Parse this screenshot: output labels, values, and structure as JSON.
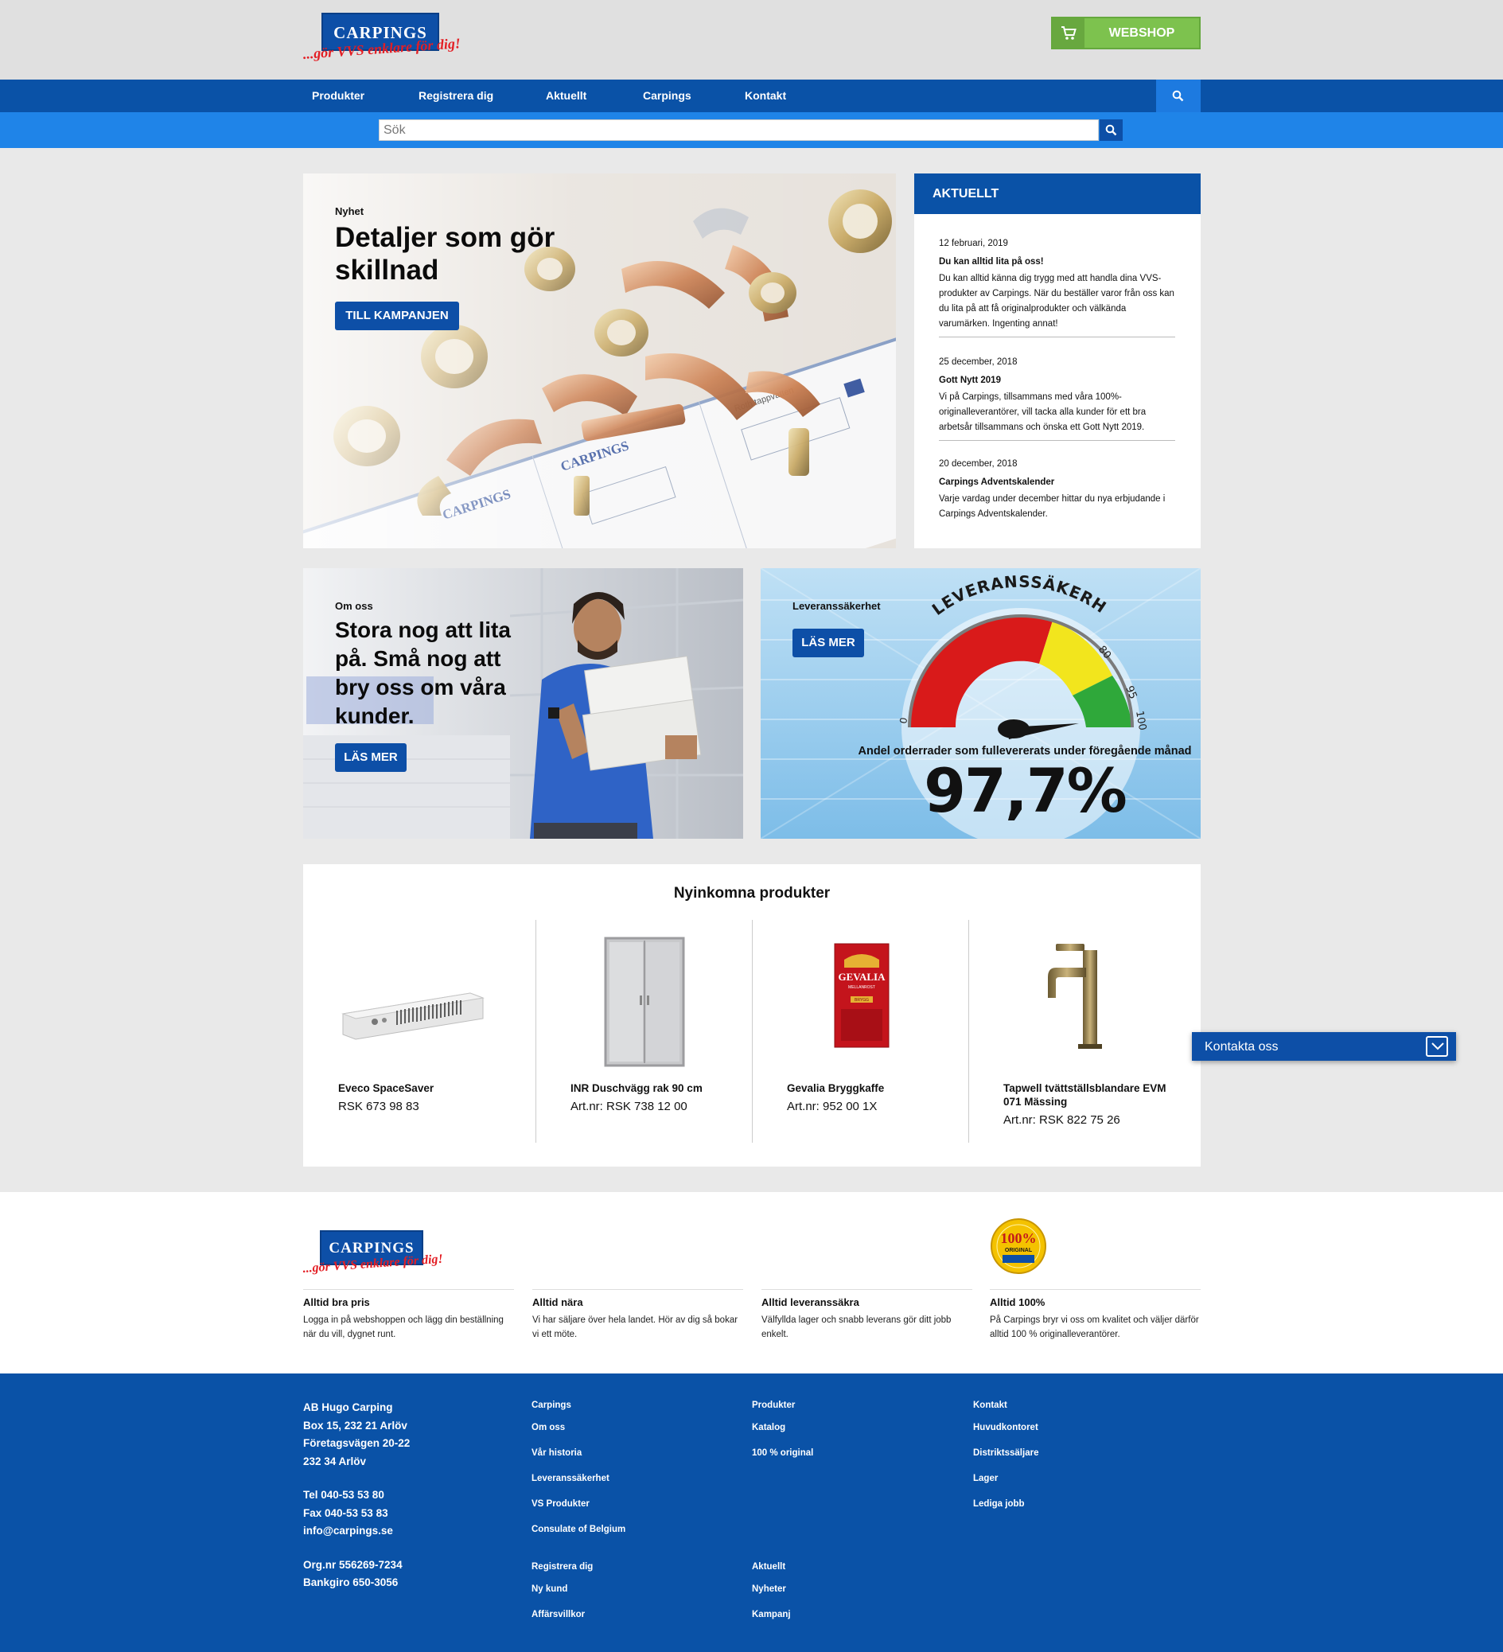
{
  "header": {
    "logo_name": "CARPINGS",
    "logo_tagline": "...gör VVS enklare för dig!",
    "webshop_label": "WEBSHOP",
    "webshop_icon": "cart-icon"
  },
  "nav": {
    "items": [
      "Produkter",
      "Registrera dig",
      "Aktuellt",
      "Carpings",
      "Kontakt"
    ],
    "search_icon": "search-icon"
  },
  "search": {
    "placeholder": "Sök"
  },
  "hero": {
    "kicker": "Nyhet",
    "title_line1": "Detaljer som gör",
    "title_line2": "skillnad",
    "button": "TILL KAMPANJEN"
  },
  "aktuellt": {
    "title": "AKTUELLT",
    "items": [
      {
        "date": "12 februari, 2019",
        "title": "Du kan alltid lita på oss!",
        "text": "Du kan alltid känna dig trygg med att handla dina VVS-produkter av Carpings. När du beställer varor från oss kan du lita på att få originalprodukter och välkända varumärken. Ingenting annat!"
      },
      {
        "date": "25 december, 2018",
        "title": "Gott Nytt 2019",
        "text": "Vi på Carpings, tillsammans med våra 100%-originalleverantörer, vill tacka alla kunder för ett bra arbetsår tillsammans och önska ett Gott Nytt 2019."
      },
      {
        "date": "20 december, 2018",
        "title": "Carpings Adventskalender",
        "text": "Varje vardag under december hittar du nya erbjudande i Carpings Adventskalender."
      }
    ]
  },
  "about": {
    "kicker": "Om oss",
    "title_lines": [
      "Stora nog att lita",
      "på. Små nog att",
      "bry oss om våra",
      "kunder."
    ],
    "button": "LÄS MER"
  },
  "delivery": {
    "kicker": "Leveranssäkerhet",
    "button": "LÄS MER",
    "gauge_title": "LEVERANSSÄKERHET",
    "gauge_ticks": [
      "0",
      "80",
      "95",
      "100"
    ],
    "caption": "Andel orderrader som fullevererats under föregående månad",
    "value": "97,7%",
    "value_num": 97.7,
    "colors": {
      "red": "#d91a1a",
      "yellow": "#f2e51d",
      "green": "#2fa83a"
    }
  },
  "products": {
    "title": "Nyinkomna produkter",
    "items": [
      {
        "name": "Eveco SpaceSaver",
        "art": "RSK 673 98 83",
        "icon": "radiator-icon"
      },
      {
        "name": "INR Duschvägg rak 90 cm",
        "art": "Art.nr: RSK 738 12 00",
        "icon": "shower-wall-icon"
      },
      {
        "name": "Gevalia Bryggkaffe",
        "art": "Art.nr: 952 00 1X",
        "icon": "coffee-pack-icon",
        "pack_brand": "GEVALIA",
        "pack_sub": "MELLANROST",
        "pack_label": "BRYGG"
      },
      {
        "name": "Tapwell tvättställsblandare EVM 071 Mässing",
        "art": "Art.nr: RSK 822 75 26",
        "icon": "faucet-icon"
      }
    ]
  },
  "contact_widget": {
    "label": "Kontakta oss",
    "icon": "chevron-down-icon"
  },
  "features": {
    "seal_text": "100%",
    "seal_sub": "ORIGINAL",
    "items": [
      {
        "title": "Alltid bra pris",
        "text": "Logga in på webshoppen och lägg din beställning när du vill, dygnet runt."
      },
      {
        "title": "Alltid nära",
        "text": "Vi har säljare över hela landet. Hör av dig så bokar vi ett möte."
      },
      {
        "title": "Alltid leveranssäkra",
        "text": "Välfyllda lager och snabb leverans gör ditt jobb enkelt."
      },
      {
        "title": "Alltid 100%",
        "text": "På Carpings bryr vi oss om kvalitet och väljer därför alltid 100 % originalleverantörer."
      }
    ]
  },
  "footer": {
    "address": [
      "AB Hugo Carping",
      "Box 15, 232 21 Arlöv",
      "Företagsvägen 20-22",
      "232 34 Arlöv"
    ],
    "phone": [
      "Tel 040-53 53 80",
      "Fax 040-53 53 83",
      "info@carpings.se"
    ],
    "org": [
      "Org.nr 556269-7234",
      "Bankgiro 650-3056"
    ],
    "carpings": {
      "title": "Carpings",
      "links": [
        "Om oss",
        "Vår historia",
        "Leveranssäkerhet",
        "VS Produkter",
        "Consulate of Belgium"
      ]
    },
    "produkter": {
      "title": "Produkter",
      "links": [
        "Katalog",
        "100 % original"
      ]
    },
    "kontakt": {
      "title": "Kontakt",
      "links": [
        "Huvudkontoret",
        "Distriktssäljare",
        "Lager",
        "Lediga jobb"
      ]
    },
    "registrera": {
      "title": "Registrera dig",
      "links": [
        "Ny kund",
        "Affärsvillkor"
      ]
    },
    "aktuellt": {
      "title": "Aktuellt",
      "links": [
        "Nyheter",
        "Kampanj"
      ]
    }
  }
}
